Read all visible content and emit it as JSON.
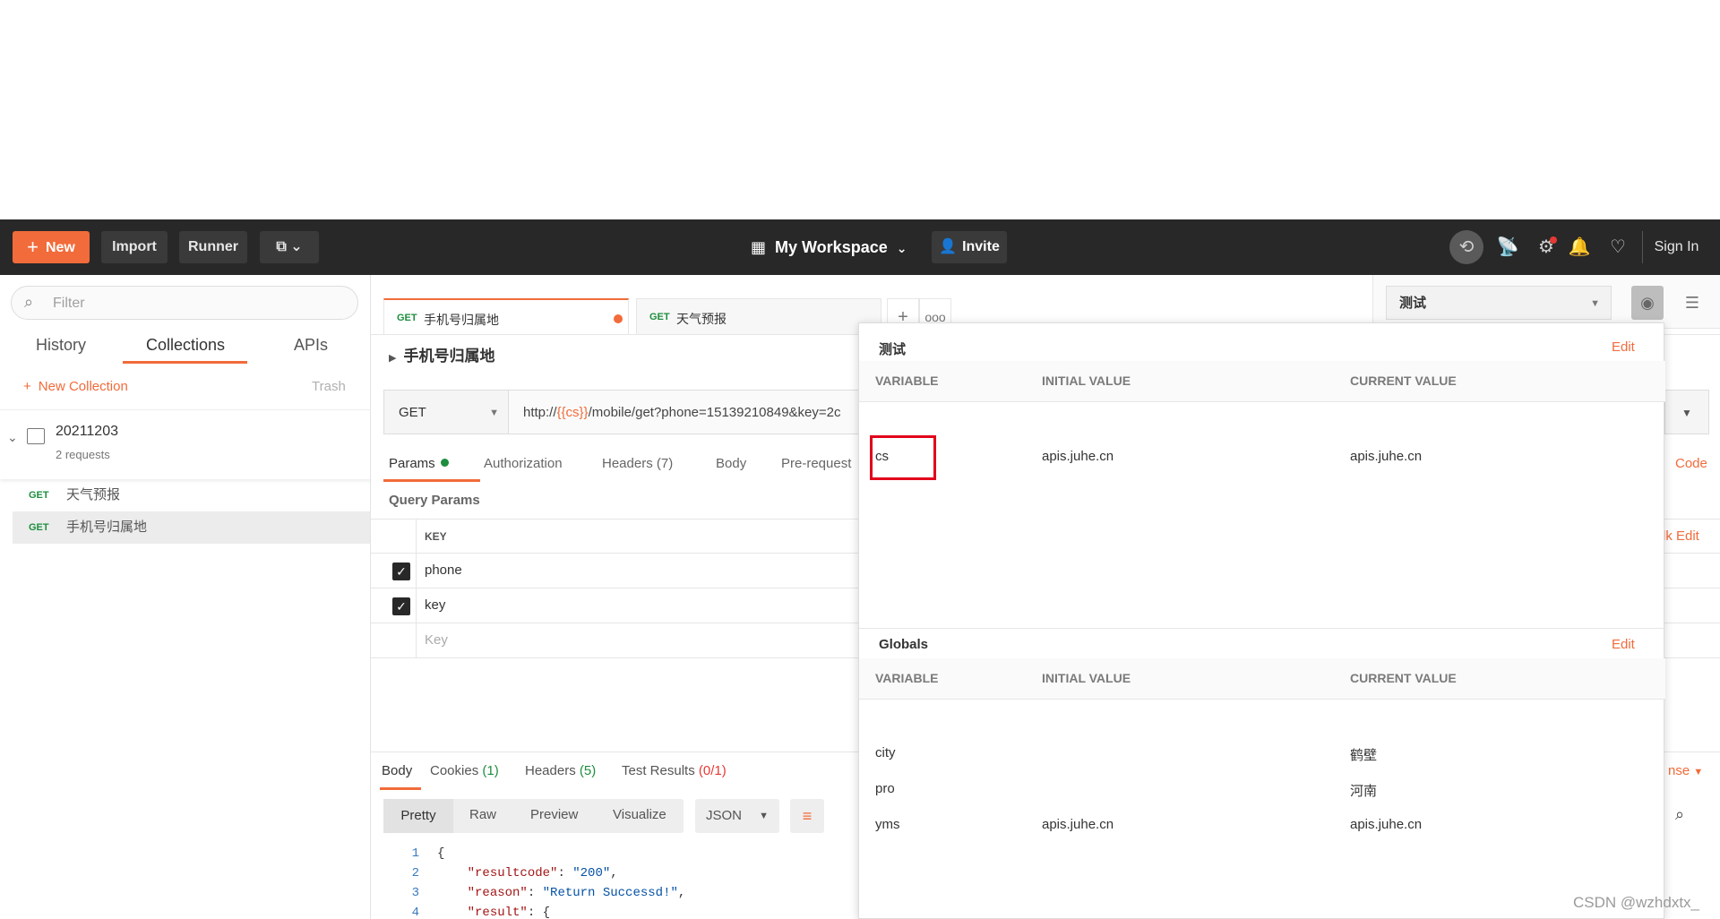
{
  "topbar": {
    "new_label": "New",
    "import_label": "Import",
    "runner_label": "Runner",
    "workspace_label": "My Workspace",
    "invite_label": "Invite",
    "signin_label": "Sign In"
  },
  "sidebar": {
    "filter_placeholder": "Filter",
    "tabs": [
      "History",
      "Collections",
      "APIs"
    ],
    "new_collection": "New Collection",
    "trash": "Trash",
    "collection": {
      "name": "20211203",
      "count": "2 requests"
    },
    "requests": [
      {
        "method": "GET",
        "name": "天气预报"
      },
      {
        "method": "GET",
        "name": "手机号归属地"
      }
    ]
  },
  "tabs": [
    {
      "method": "GET",
      "name": "手机号归属地"
    },
    {
      "method": "GET",
      "name": "天气预报"
    }
  ],
  "request": {
    "title": "手机号归属地",
    "method": "GET",
    "url_prefix": "http://",
    "url_var": "{{cs}}",
    "url_suffix": "/mobile/get?phone=15139210849&key=2c",
    "param_tabs": [
      "Params",
      "Authorization",
      "Headers (7)",
      "Body",
      "Pre-request"
    ],
    "code": "Code",
    "query_params_title": "Query Params",
    "key_header": "KEY",
    "params": [
      {
        "key": "phone"
      },
      {
        "key": "key"
      }
    ],
    "key_placeholder": "Key",
    "bulk_edit": "lk Edit"
  },
  "response": {
    "tabs": [
      "Body",
      "Cookies",
      "(1)",
      "Headers",
      "(5)",
      "Test Results",
      "(0/1)"
    ],
    "opts": "nse",
    "format_buttons": [
      "Pretty",
      "Raw",
      "Preview",
      "Visualize"
    ],
    "format": "JSON",
    "code_lines": [
      {
        "n": "1",
        "text": "{"
      },
      {
        "n": "2",
        "key": "\"resultcode\"",
        "val": "\"200\""
      },
      {
        "n": "3",
        "key": "\"reason\"",
        "val": "\"Return Successd!\""
      },
      {
        "n": "4",
        "key": "\"result\"",
        "val": "{"
      }
    ]
  },
  "env": {
    "selected": "测试"
  },
  "popover": {
    "env_title": "测试",
    "edit": "Edit",
    "headers": [
      "VARIABLE",
      "INITIAL VALUE",
      "CURRENT VALUE"
    ],
    "env_vars": [
      {
        "variable": "cs",
        "initial": "apis.juhe.cn",
        "current": "apis.juhe.cn"
      }
    ],
    "globals_title": "Globals",
    "globals": [
      {
        "variable": "city",
        "initial": "",
        "current": "鹤壁"
      },
      {
        "variable": "pro",
        "initial": "",
        "current": "河南"
      },
      {
        "variable": "yms",
        "initial": "apis.juhe.cn",
        "current": "apis.juhe.cn"
      }
    ]
  },
  "watermark": "CSDN @wzhdxtx_",
  "colors": {
    "accent": "#f26b3a",
    "topbar": "#282828",
    "highlight": "#e2001a",
    "get": "#1e8e3e"
  }
}
